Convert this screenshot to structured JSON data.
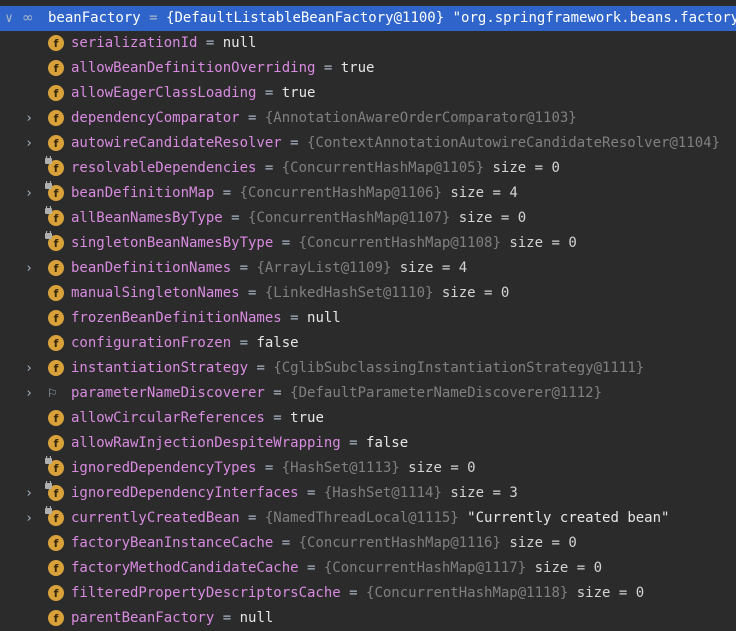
{
  "root": {
    "expander": "∨",
    "icon": "infinity-icon",
    "name": "beanFactory",
    "eq": " = ",
    "ref": "{DefaultListableBeanFactory@1100}",
    "str": " \"org.springframework.beans.factory"
  },
  "rows": [
    {
      "name": "serializationId",
      "eq": " = ",
      "plain": "null",
      "expand": false,
      "icon": "field",
      "lock": false
    },
    {
      "name": "allowBeanDefinitionOverriding",
      "eq": " = ",
      "plain": "true",
      "expand": false,
      "icon": "field",
      "lock": false
    },
    {
      "name": "allowEagerClassLoading",
      "eq": " = ",
      "plain": "true",
      "expand": false,
      "icon": "field",
      "lock": false
    },
    {
      "name": "dependencyComparator",
      "eq": " = ",
      "ref": "{AnnotationAwareOrderComparator@1103}",
      "expand": true,
      "icon": "field",
      "lock": false
    },
    {
      "name": "autowireCandidateResolver",
      "eq": " = ",
      "ref": "{ContextAnnotationAutowireCandidateResolver@1104}",
      "expand": true,
      "icon": "field",
      "lock": false
    },
    {
      "name": "resolvableDependencies",
      "eq": " = ",
      "ref": "{ConcurrentHashMap@1105}",
      "size": "  size = 0",
      "expand": false,
      "icon": "field",
      "lock": true
    },
    {
      "name": "beanDefinitionMap",
      "eq": " = ",
      "ref": "{ConcurrentHashMap@1106}",
      "size": "  size = 4",
      "expand": true,
      "icon": "field",
      "lock": true
    },
    {
      "name": "allBeanNamesByType",
      "eq": " = ",
      "ref": "{ConcurrentHashMap@1107}",
      "size": "  size = 0",
      "expand": false,
      "icon": "field",
      "lock": true
    },
    {
      "name": "singletonBeanNamesByType",
      "eq": " = ",
      "ref": "{ConcurrentHashMap@1108}",
      "size": "  size = 0",
      "expand": false,
      "icon": "field",
      "lock": true
    },
    {
      "name": "beanDefinitionNames",
      "eq": " = ",
      "ref": "{ArrayList@1109}",
      "size": "  size = 4",
      "expand": true,
      "icon": "field",
      "lock": false
    },
    {
      "name": "manualSingletonNames",
      "eq": " = ",
      "ref": "{LinkedHashSet@1110}",
      "size": "  size = 0",
      "expand": false,
      "icon": "field",
      "lock": false
    },
    {
      "name": "frozenBeanDefinitionNames",
      "eq": " = ",
      "plain": "null",
      "expand": false,
      "icon": "field",
      "lock": false
    },
    {
      "name": "configurationFrozen",
      "eq": " = ",
      "plain": "false",
      "expand": false,
      "icon": "field",
      "lock": false
    },
    {
      "name": "instantiationStrategy",
      "eq": " = ",
      "ref": "{CglibSubclassingInstantiationStrategy@1111}",
      "expand": true,
      "icon": "field",
      "lock": false
    },
    {
      "name": "parameterNameDiscoverer",
      "eq": " = ",
      "ref": "{DefaultParameterNameDiscoverer@1112}",
      "expand": true,
      "icon": "flag",
      "lock": false
    },
    {
      "name": "allowCircularReferences",
      "eq": " = ",
      "plain": "true",
      "expand": false,
      "icon": "field",
      "lock": false
    },
    {
      "name": "allowRawInjectionDespiteWrapping",
      "eq": " = ",
      "plain": "false",
      "expand": false,
      "icon": "field",
      "lock": false
    },
    {
      "name": "ignoredDependencyTypes",
      "eq": " = ",
      "ref": "{HashSet@1113}",
      "size": "  size = 0",
      "expand": false,
      "icon": "field",
      "lock": true
    },
    {
      "name": "ignoredDependencyInterfaces",
      "eq": " = ",
      "ref": "{HashSet@1114}",
      "size": "  size = 3",
      "expand": true,
      "icon": "field",
      "lock": true
    },
    {
      "name": "currentlyCreatedBean",
      "eq": " = ",
      "ref": "{NamedThreadLocal@1115}",
      "str": " \"Currently created bean\"",
      "expand": true,
      "icon": "field",
      "lock": true
    },
    {
      "name": "factoryBeanInstanceCache",
      "eq": " = ",
      "ref": "{ConcurrentHashMap@1116}",
      "size": "  size = 0",
      "expand": false,
      "icon": "field",
      "lock": false
    },
    {
      "name": "factoryMethodCandidateCache",
      "eq": " = ",
      "ref": "{ConcurrentHashMap@1117}",
      "size": "  size = 0",
      "expand": false,
      "icon": "field",
      "lock": false
    },
    {
      "name": "filteredPropertyDescriptorsCache",
      "eq": " = ",
      "ref": "{ConcurrentHashMap@1118}",
      "size": "  size = 0",
      "expand": false,
      "icon": "field",
      "lock": false
    },
    {
      "name": "parentBeanFactory",
      "eq": " = ",
      "plain": "null",
      "expand": false,
      "icon": "field",
      "lock": false
    }
  ],
  "glyphs": {
    "expand_collapsed": "›",
    "field_letter": "f",
    "flag": "⚐",
    "infinity": "∞"
  },
  "colors": {
    "background": "#2b2b2b",
    "selection": "#2f65ca",
    "field_name": "#d88be0",
    "reference": "#808080",
    "field_icon": "#d8a13a"
  }
}
